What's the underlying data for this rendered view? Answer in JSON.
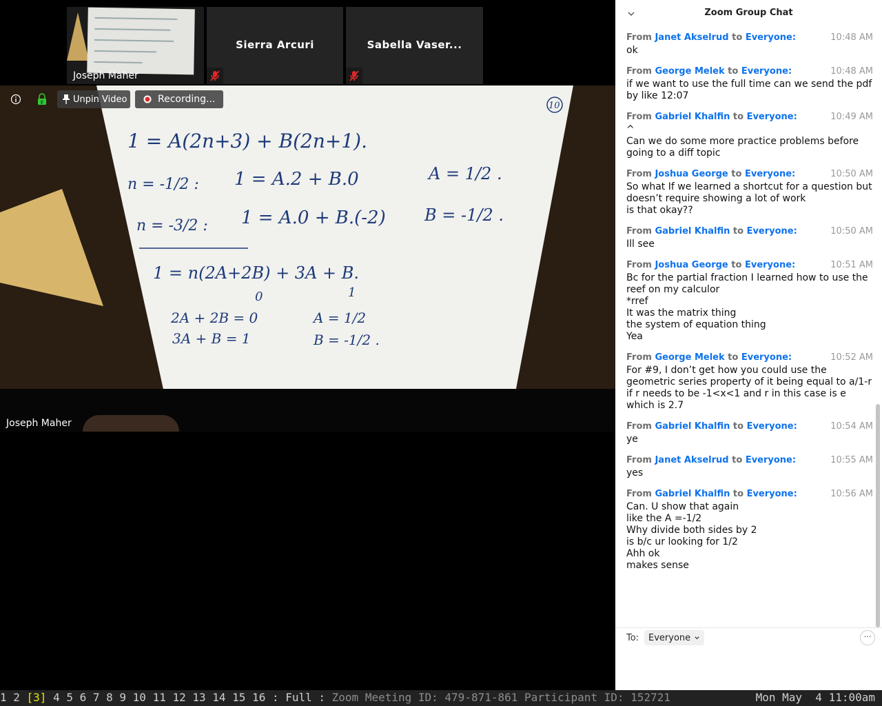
{
  "video": {
    "thumbnails": [
      {
        "name": "Joseph Maher"
      },
      {
        "name": "Sierra Arcuri"
      },
      {
        "name": "Sabella Vaser..."
      }
    ],
    "toolbar": {
      "unpin_label": "Unpin Video",
      "recording_label": "Recording..."
    },
    "speaker_name": "Joseph Maher",
    "whiteboard": {
      "page_number": "10",
      "line1": "1 = A(2n+3) + B(2n+1).",
      "line2a": "n = -1/2 :",
      "line2b": "1 = A.2 + B.0",
      "line2c": "A = 1/2 .",
      "line3a": "n = -3/2 :",
      "line3b": "1 = A.0 + B.(-2)",
      "line3c": "B = -1/2 .",
      "line4": "1 = n(2A+2B) + 3A + B.",
      "under0": "0",
      "under1": "1",
      "sys1": "2A + 2B = 0",
      "sys2": "3A + B = 1",
      "res1": "A = 1/2",
      "res2": "B = -1/2 ."
    }
  },
  "chat": {
    "title": "Zoom Group Chat",
    "messages": [
      {
        "from": "Janet Akselrud",
        "to": "Everyone:",
        "time": "10:48 AM",
        "text": "ok"
      },
      {
        "from": "George Melek",
        "to": "Everyone:",
        "time": "10:48 AM",
        "text": "if we want to use the full time can we send the pdf by like 12:07"
      },
      {
        "from": "Gabriel Khalfin",
        "to": "Everyone:",
        "time": "10:49 AM",
        "text": "^\nCan we do some more practice problems before going to a diff topic"
      },
      {
        "from": "Joshua George",
        "to": "Everyone:",
        "time": "10:50 AM",
        "text": "So what If we learned a shortcut for a question but doesn’t require showing a lot of work\nis that okay??"
      },
      {
        "from": "Gabriel Khalfin",
        "to": "Everyone:",
        "time": "10:50 AM",
        "text": "Ill see"
      },
      {
        "from": "Joshua George",
        "to": "Everyone:",
        "time": "10:51 AM",
        "text": "Bc for the partial fraction I learned how to use the reef on my calculor\n*rref\nIt was the matrix thing\nthe system of equation thing\nYea"
      },
      {
        "from": "George Melek",
        "to": "Everyone:",
        "time": "10:52 AM",
        "text": "For #9, I don’t get how you could use the geometric series property of it being equal to a/1-r if r needs to be -1<x<1 and r in this case is e which is 2.7"
      },
      {
        "from": "Gabriel Khalfin",
        "to": "Everyone:",
        "time": "10:54 AM",
        "text": "ye"
      },
      {
        "from": "Janet Akselrud",
        "to": "Everyone:",
        "time": "10:55 AM",
        "text": "yes"
      },
      {
        "from": "Gabriel Khalfin",
        "to": "Everyone:",
        "time": "10:56 AM",
        "text": "Can. U show that again\nlike the A =-1/2\nWhy divide both sides by 2\nis b/c ur looking for 1/2\nAhh ok\nmakes sense"
      }
    ],
    "labels": {
      "from": "From",
      "to": "to"
    },
    "to_label": "To:",
    "recipient": "Everyone",
    "more": "···"
  },
  "statusbar": {
    "workspaces_before": "1 2 ",
    "current": "[3]",
    "workspaces_after": " 4 5 6 7 8 9 10 11 12 13 14 15 16 : Full : ",
    "meeting": "Zoom Meeting ID: 479-871-861 Participant ID: 152721",
    "clock": "Mon May  4 11:00am"
  },
  "colors": {
    "accent": "#0e72ed",
    "recording": "#e02828",
    "status_current": "#e6e600"
  }
}
